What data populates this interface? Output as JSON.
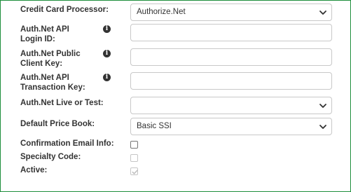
{
  "fields": {
    "processor": {
      "label": "Credit Card Processor:",
      "value": "Authorize.Net"
    },
    "login_id": {
      "label_line1": "Auth.Net API",
      "label_line2": "Login ID:",
      "value": ""
    },
    "public_key": {
      "label_line1": "Auth.Net Public",
      "label_line2": "Client Key:",
      "value": ""
    },
    "transaction_key": {
      "label_line1": "Auth.Net API",
      "label_line2": "Transaction Key:",
      "value": ""
    },
    "live_or_test": {
      "label": "Auth.Net Live or Test:",
      "value": ""
    },
    "price_book": {
      "label": "Default Price Book:",
      "value": "Basic SSI"
    },
    "confirmation_email": {
      "label": "Confirmation Email Info:",
      "checked": false
    },
    "specialty_code": {
      "label": "Specialty Code:",
      "checked": false,
      "disabled": true
    },
    "active": {
      "label": "Active:",
      "checked": true,
      "disabled": true
    }
  },
  "info_icon": "info-circle",
  "colors": {
    "frame_border": "#1e8f3c",
    "input_border": "#c8c8c8",
    "text": "#333333"
  }
}
